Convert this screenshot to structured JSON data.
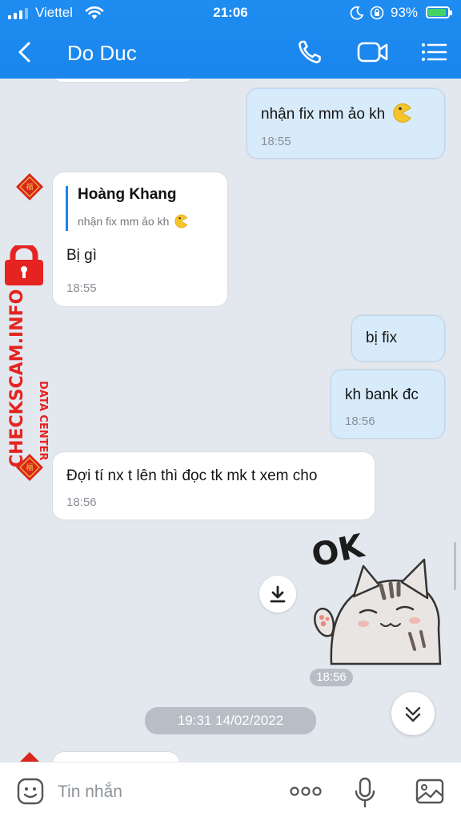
{
  "status_bar": {
    "carrier": "Viettel",
    "time": "21:06",
    "battery_percent": "93%",
    "battery_level": 0.93
  },
  "header": {
    "title": "Do Duc",
    "icons": [
      "back-arrow-icon",
      "phone-icon",
      "video-call-icon",
      "menu-list-icon"
    ]
  },
  "messages": [
    {
      "side": "me",
      "text": "nhận fix mm ảo kh",
      "emoji": "pacman-emoji",
      "time": "18:55"
    },
    {
      "side": "them",
      "quote_name": "Hoàng Khang",
      "quote_text": "nhận fix mm ảo kh",
      "text": "Bị gì",
      "time": "18:55"
    },
    {
      "side": "me",
      "text": "bị fix"
    },
    {
      "side": "me",
      "text": "kh bank đc",
      "time": "18:56"
    },
    {
      "side": "them",
      "text": "Đợi tí nx t lên thì đọc tk mk t xem cho",
      "time": "18:56"
    },
    {
      "side": "me",
      "type": "sticker",
      "sticker": "ok-cat-sticker",
      "sticker_text": "OK",
      "time": "18:56"
    }
  ],
  "date_separator": "19:31 14/02/2022",
  "watermark": {
    "line1": "DATA CENTER",
    "line2": "CHECKSCAM.INFO"
  },
  "composer": {
    "placeholder": "Tin nhắn",
    "icons": [
      "sticker-emoji-icon",
      "more-dots-icon",
      "microphone-icon",
      "image-icon"
    ]
  },
  "colors": {
    "header_blue": "#1a86ee",
    "my_bubble": "#d8ebfb",
    "their_bubble": "#ffffff",
    "chat_background": "#e2e8ee",
    "watermark_red": "#e52421"
  }
}
